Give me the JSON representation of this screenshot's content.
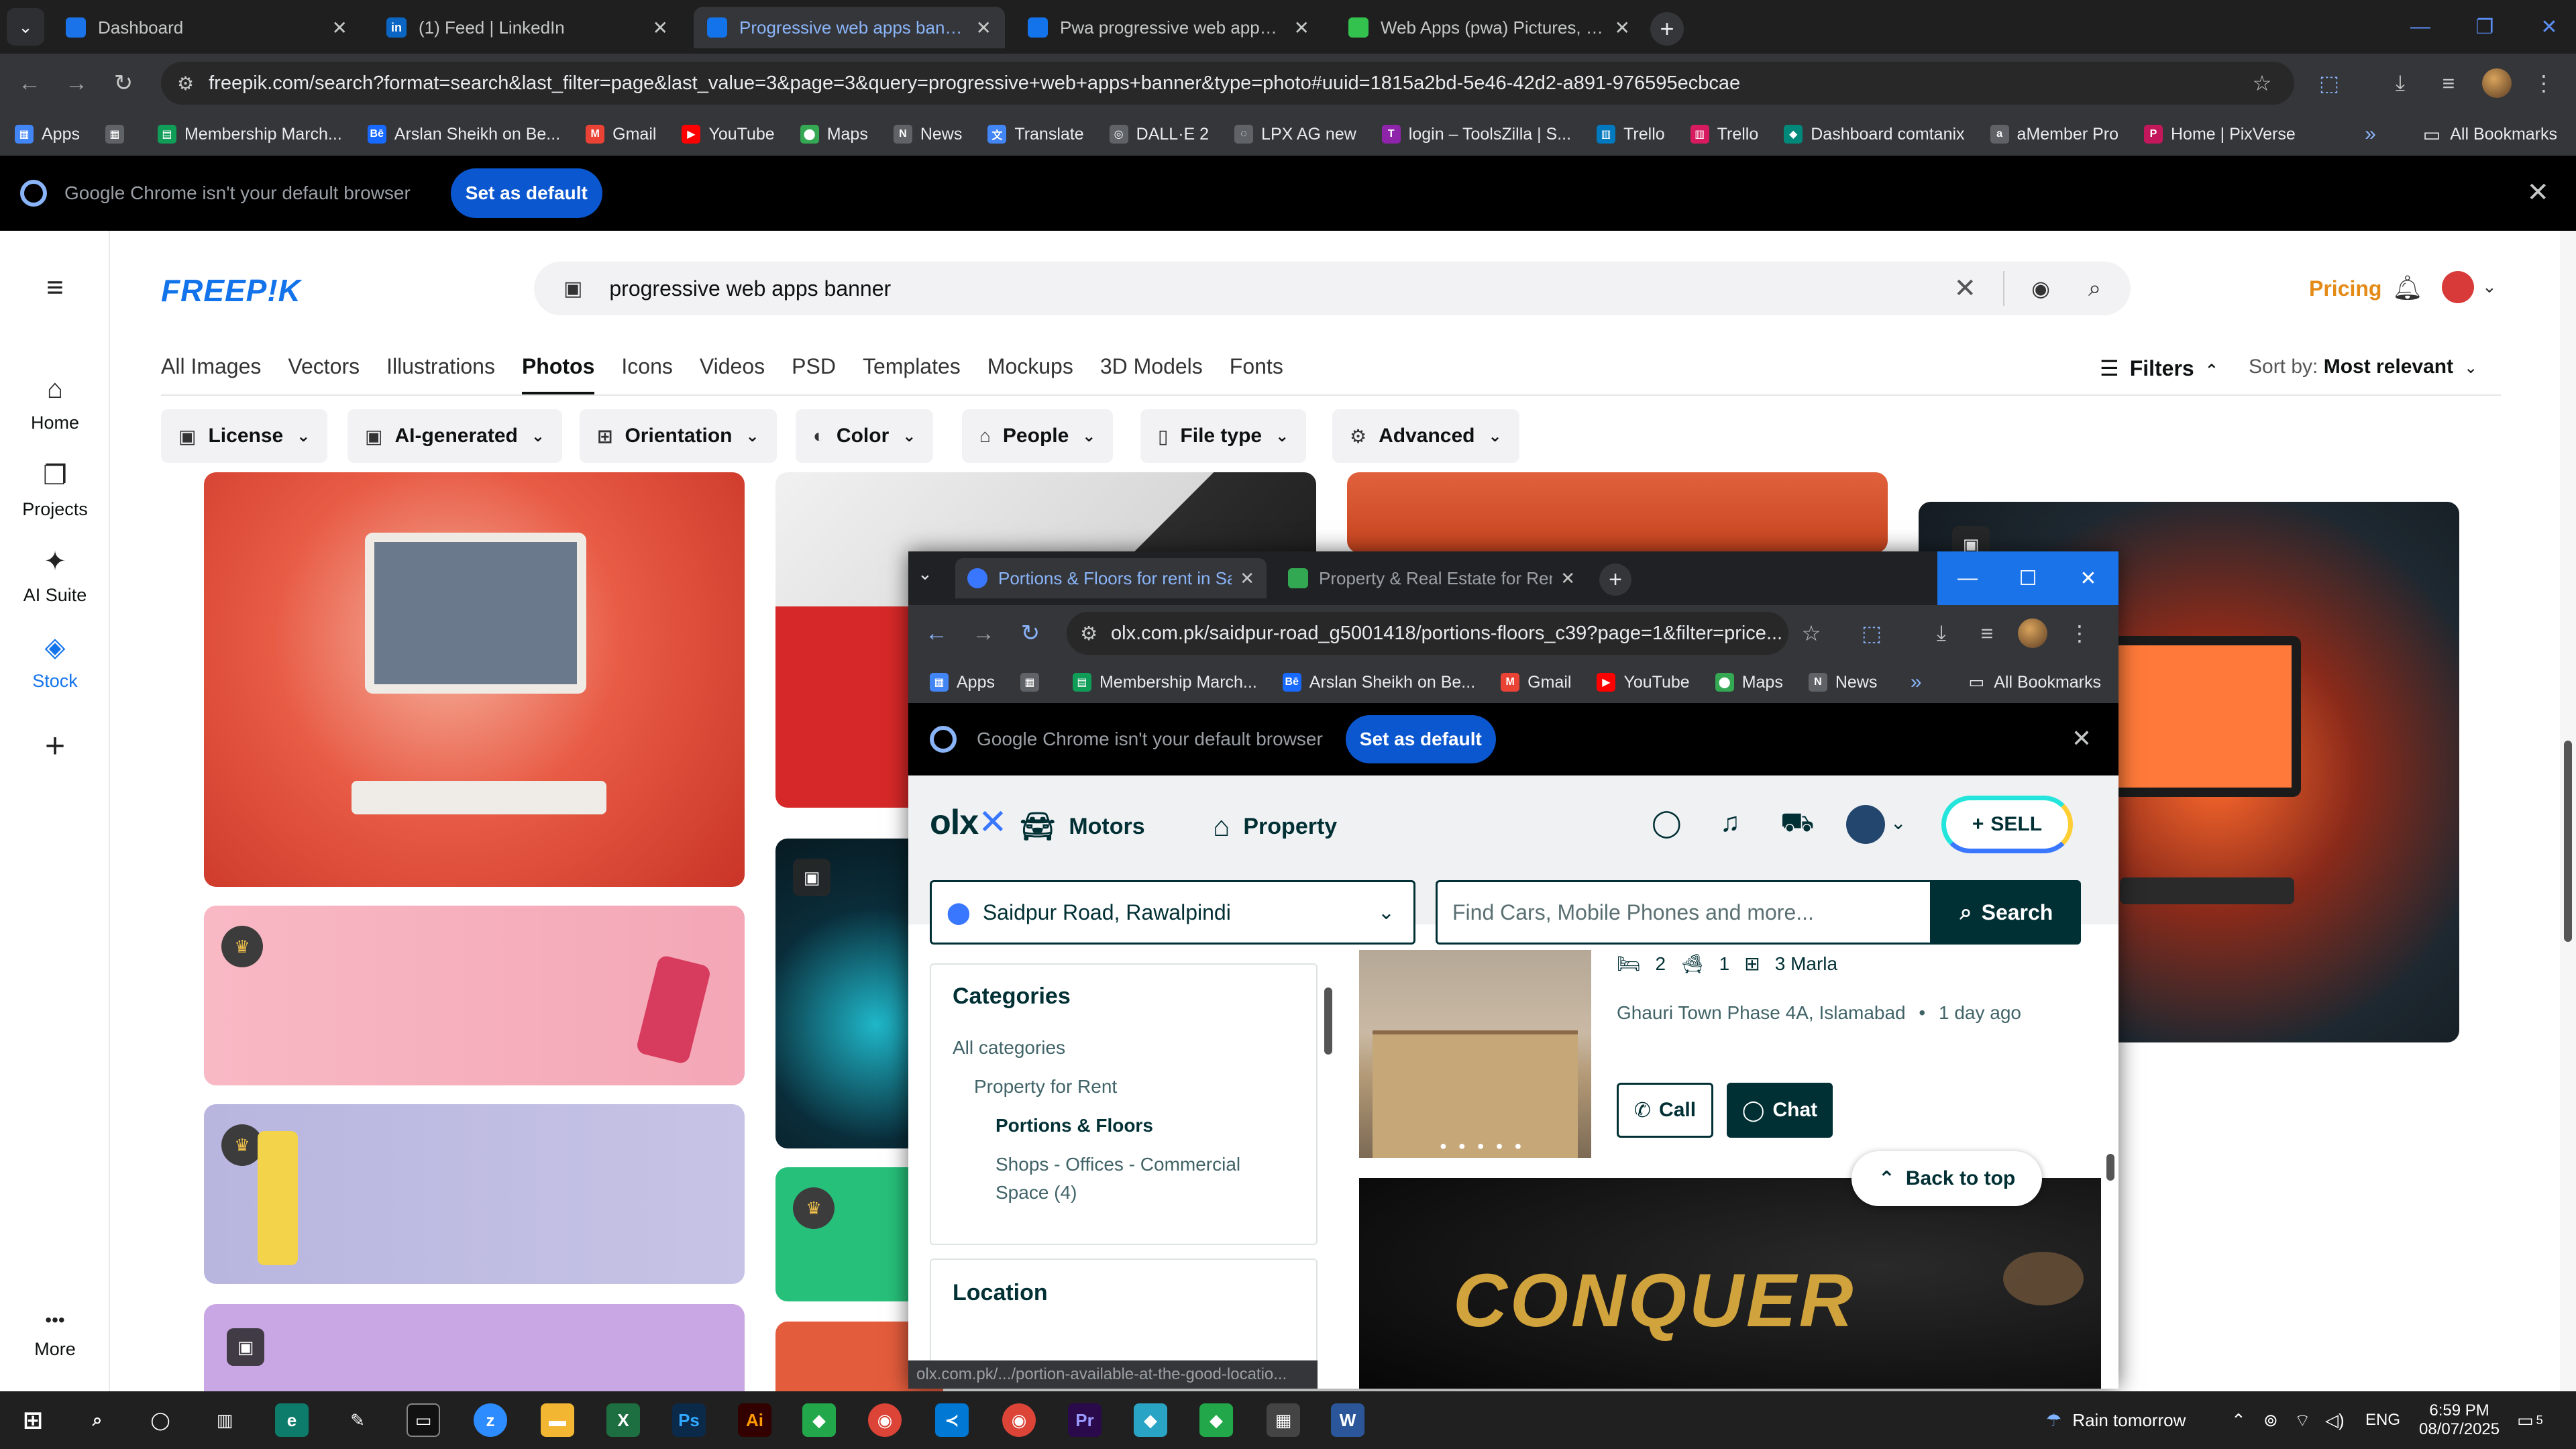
{
  "browser": {
    "tabs": [
      {
        "title": "Dashboard",
        "favicon_color": "#1a73e8",
        "active": false
      },
      {
        "title": "(1) Feed | LinkedIn",
        "favicon_color": "#0a66c2",
        "favicon_text": "in",
        "active": false
      },
      {
        "title": "Progressive web apps banner P",
        "favicon_color": "#1273eb",
        "active": true
      },
      {
        "title": "Pwa progressive web apps sma",
        "favicon_color": "#1273eb",
        "active": false
      },
      {
        "title": "Web Apps (pwa) Pictures, Imag",
        "favicon_color": "#33c24d",
        "active": false
      }
    ],
    "url": "freepik.com/search?format=search&last_filter=page&last_value=3&page=3&query=progressive+web+apps+banner&type=photo#uuid=1815a2bd-5e46-42d2-a891-976595ecbcae",
    "bookmarks": [
      {
        "label": "Apps",
        "color": "#4285f4"
      },
      {
        "label": "",
        "color": "#5f6368"
      },
      {
        "label": "Membership March...",
        "color": "#0f9d58"
      },
      {
        "label": "Arslan Sheikh on Be...",
        "color": "#1769ff"
      },
      {
        "label": "Gmail",
        "color": "#ea4335"
      },
      {
        "label": "YouTube",
        "color": "#ff0000"
      },
      {
        "label": "Maps",
        "color": "#34a853"
      },
      {
        "label": "News",
        "color": "#5f6368"
      },
      {
        "label": "Translate",
        "color": "#4285f4"
      },
      {
        "label": "DALL·E 2",
        "color": "#5f6368"
      },
      {
        "label": "LPX AG new",
        "color": "#5f6368"
      },
      {
        "label": "login – ToolsZilla | S...",
        "color": "#8e24aa"
      },
      {
        "label": "Trello",
        "color": "#0079bf"
      },
      {
        "label": "Trello",
        "color": "#d81b60"
      },
      {
        "label": "Dashboard comtanix",
        "color": "#00897b"
      },
      {
        "label": "aMember Pro",
        "color": "#5f6368"
      },
      {
        "label": "Home | PixVerse",
        "color": "#c2185b"
      }
    ],
    "all_bookmarks": "All Bookmarks",
    "overflow": "»",
    "infobar": {
      "message": "Google Chrome isn't your default browser",
      "button": "Set as default"
    }
  },
  "freepik": {
    "logo": "FREEP!K",
    "search_value": "progressive web apps banner",
    "pricing": "Pricing",
    "left_nav": [
      {
        "label": "Home",
        "icon": "⌂"
      },
      {
        "label": "Projects",
        "icon": "❐"
      },
      {
        "label": "AI Suite",
        "icon": "✦"
      },
      {
        "label": "Stock",
        "icon": "◈"
      },
      {
        "label": "",
        "icon": "+"
      },
      {
        "label": "More",
        "icon": "•••"
      }
    ],
    "category_tabs": [
      "All Images",
      "Vectors",
      "Illustrations",
      "Photos",
      "Icons",
      "Videos",
      "PSD",
      "Templates",
      "Mockups",
      "3D Models",
      "Fonts"
    ],
    "active_tab": "Photos",
    "filters_label": "Filters",
    "sort_label": "Sort by:",
    "sort_value": "Most relevant",
    "filter_chips": [
      {
        "label": "License",
        "icon": "▣"
      },
      {
        "label": "AI-generated",
        "icon": "▣"
      },
      {
        "label": "Orientation",
        "icon": "⊞"
      },
      {
        "label": "Color",
        "icon": "◐"
      },
      {
        "label": "People",
        "icon": "⌂"
      },
      {
        "label": "File type",
        "icon": "▯"
      },
      {
        "label": "Advanced",
        "icon": "⚙"
      }
    ]
  },
  "olx_window": {
    "tabs": [
      {
        "title": "Portions & Floors for rent in Sa",
        "active": true
      },
      {
        "title": "Property & Real Estate for Rent",
        "active": false
      }
    ],
    "url": "olx.com.pk/saidpur-road_g5001418/portions-floors_c39?page=1&filter=price...",
    "bookmarks": [
      "Apps",
      "Membership March...",
      "Arslan Sheikh on Be...",
      "Gmail",
      "YouTube",
      "Maps",
      "News"
    ],
    "all_bookmarks": "All Bookmarks",
    "infobar": {
      "message": "Google Chrome isn't your default browser",
      "button": "Set as default"
    },
    "nav": {
      "motors": "Motors",
      "property": "Property",
      "sell": "SELL"
    },
    "location": "Saidpur Road, Rawalpindi",
    "search_placeholder": "Find Cars, Mobile Phones and more...",
    "search_button": "Search",
    "categories": {
      "title": "Categories",
      "items": [
        "All categories",
        "Property for Rent",
        "Portions & Floors",
        "Shops - Offices - Commercial",
        "Space (4)"
      ]
    },
    "location_title": "Location",
    "listing": {
      "beds": "2",
      "baths": "1",
      "area": "3 Marla",
      "location": "Ghauri Town Phase 4A, Islamabad",
      "time": "1 day ago",
      "call": "Call",
      "chat": "Chat"
    },
    "back_to_top": "Back to top",
    "banner_text": "CONQUER",
    "status_url": "olx.com.pk/.../portion-available-at-the-good-locatio..."
  },
  "taskbar": {
    "weather": "Rain tomorrow",
    "lang": "ENG",
    "time": "6:59 PM",
    "date": "08/07/2025",
    "notif_count": "5"
  }
}
